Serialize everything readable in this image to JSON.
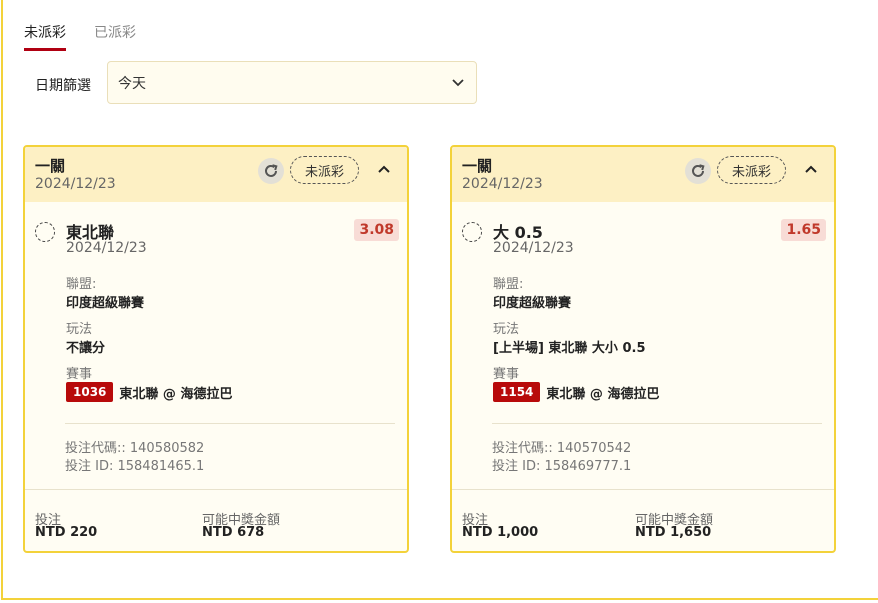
{
  "tabs": [
    {
      "label": "未派彩",
      "active": true
    },
    {
      "label": "已派彩",
      "active": false
    }
  ],
  "filter": {
    "label": "日期篩選",
    "value": "今天"
  },
  "colors": {
    "accent_border": "#f3d23a",
    "tab_underline": "#b00012",
    "badge": "#b80a0a",
    "odds_text": "#c0392b"
  },
  "cards": [
    {
      "title": "一關",
      "date": "2024/12/23",
      "status": "未派彩",
      "selection": "東北聯",
      "selection_date": "2024/12/23",
      "odds": "3.08",
      "league_label": "聯盟:",
      "league": "印度超級聯賽",
      "play_label": "玩法",
      "play": "不讓分",
      "event_label": "賽事",
      "event_id": "1036",
      "event_name": "東北聯 @ 海德拉巴",
      "bet_code": "投注代碼:: 140580582",
      "bet_id": "投注 ID: 158481465.1",
      "stake_label": "投注",
      "stake": "NTD 220",
      "payout_label": "可能中獎金額",
      "payout": "NTD 678"
    },
    {
      "title": "一關",
      "date": "2024/12/23",
      "status": "未派彩",
      "selection": "大 0.5",
      "selection_date": "2024/12/23",
      "odds": "1.65",
      "league_label": "聯盟:",
      "league": "印度超級聯賽",
      "play_label": "玩法",
      "play": "[上半場] 東北聯 大小 0.5",
      "event_label": "賽事",
      "event_id": "1154",
      "event_name": "東北聯 @ 海德拉巴",
      "bet_code": "投注代碼:: 140570542",
      "bet_id": "投注 ID: 158469777.1",
      "stake_label": "投注",
      "stake": "NTD 1,000",
      "payout_label": "可能中獎金額",
      "payout": "NTD 1,650"
    }
  ]
}
